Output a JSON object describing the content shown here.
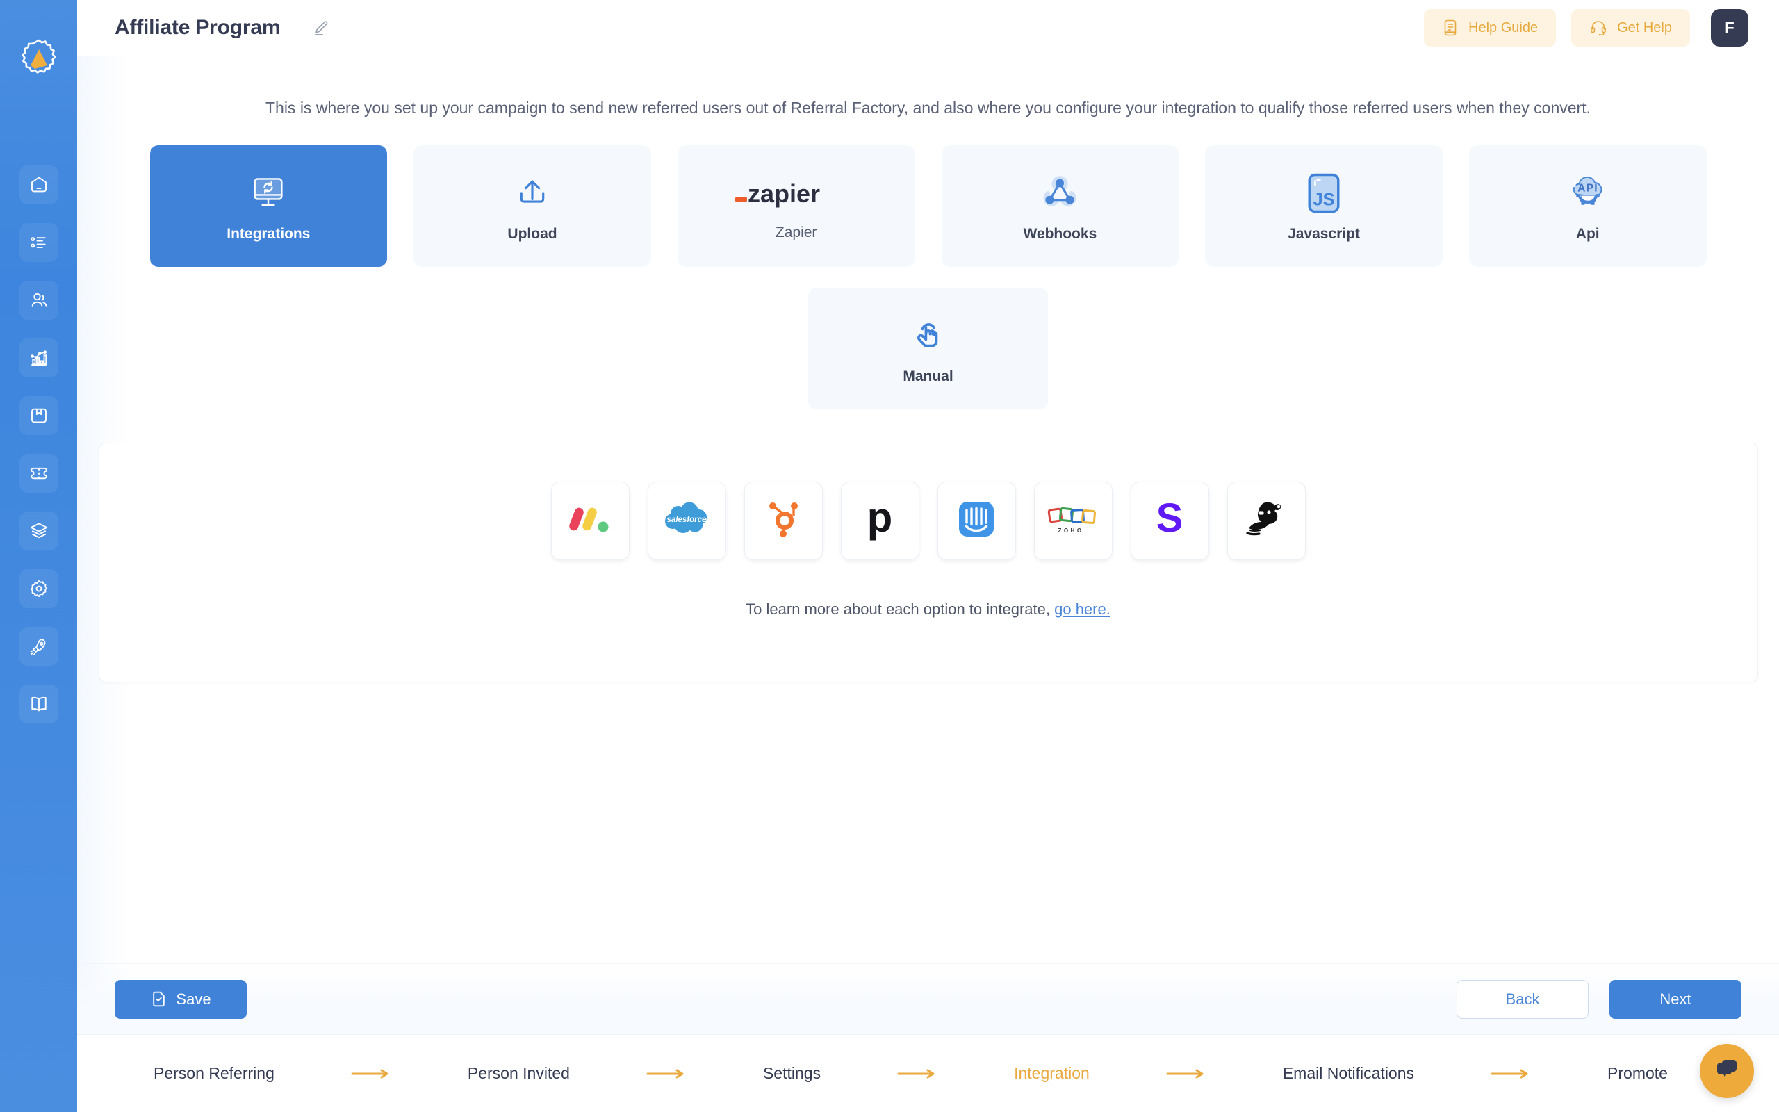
{
  "app": {
    "brand_color": "#3f82d8",
    "accent_color": "#eaa93e",
    "logo_name": "referral-factory-logo"
  },
  "sidebar": {
    "items": [
      {
        "icon": "home-icon",
        "name": "dashboard"
      },
      {
        "icon": "list-icon",
        "name": "campaigns"
      },
      {
        "icon": "users-icon",
        "name": "users"
      },
      {
        "icon": "analytics-icon",
        "name": "analytics"
      },
      {
        "icon": "box-icon",
        "name": "rewards"
      },
      {
        "icon": "ticket-icon",
        "name": "coupons"
      },
      {
        "icon": "layers-icon",
        "name": "templates"
      },
      {
        "icon": "gear-icon",
        "name": "settings"
      },
      {
        "icon": "rocket-icon",
        "name": "promote"
      },
      {
        "icon": "book-icon",
        "name": "docs"
      }
    ]
  },
  "header": {
    "title": "Affiliate Program",
    "edit_icon": "pencil-icon",
    "help_guide_label": "Help Guide",
    "help_guide_icon": "document-icon",
    "get_help_label": "Get Help",
    "get_help_icon": "headset-icon",
    "avatar_initial": "F"
  },
  "main": {
    "intro": "This is where you set up your campaign to send new referred users out of Referral Factory, and also where you configure your integration to qualify those referred users when they convert.",
    "options": [
      {
        "label": "Integrations",
        "icon": "monitor-sync-icon",
        "active": true,
        "type": "icon"
      },
      {
        "label": "Upload",
        "icon": "upload-icon",
        "active": false,
        "type": "icon"
      },
      {
        "label": "Zapier",
        "icon": "zapier-logo",
        "active": false,
        "type": "logo"
      },
      {
        "label": "Webhooks",
        "icon": "webhook-icon",
        "active": false,
        "type": "icon"
      },
      {
        "label": "Javascript",
        "icon": "js-file-icon",
        "active": false,
        "type": "icon"
      },
      {
        "label": "Api",
        "icon": "api-cloud-icon",
        "active": false,
        "type": "icon"
      }
    ],
    "option_row2": [
      {
        "label": "Manual",
        "icon": "hand-click-icon",
        "active": false,
        "type": "icon"
      }
    ],
    "panel": {
      "integrations": [
        {
          "name": "monday-logo",
          "label": "Monday.com"
        },
        {
          "name": "salesforce-logo",
          "label": "Salesforce"
        },
        {
          "name": "hubspot-logo",
          "label": "HubSpot"
        },
        {
          "name": "pipedrive-logo",
          "label": "Pipedrive"
        },
        {
          "name": "intercom-logo",
          "label": "Intercom"
        },
        {
          "name": "zoho-logo",
          "label": "Zoho"
        },
        {
          "name": "stripe-logo",
          "label": "Stripe"
        },
        {
          "name": "mailchimp-logo",
          "label": "Mailchimp"
        }
      ],
      "note_text": "To learn more about each option to integrate, ",
      "note_link": "go here."
    }
  },
  "actions": {
    "save_label": "Save",
    "save_icon": "save-file-icon",
    "back_label": "Back",
    "next_label": "Next"
  },
  "stepper": {
    "steps": [
      {
        "label": "Person Referring",
        "current": false
      },
      {
        "label": "Person Invited",
        "current": false
      },
      {
        "label": "Settings",
        "current": false
      },
      {
        "label": "Integration",
        "current": true
      },
      {
        "label": "Email Notifications",
        "current": false
      },
      {
        "label": "Promote",
        "current": false
      }
    ]
  },
  "chat": {
    "icon": "chat-bubble-icon"
  }
}
